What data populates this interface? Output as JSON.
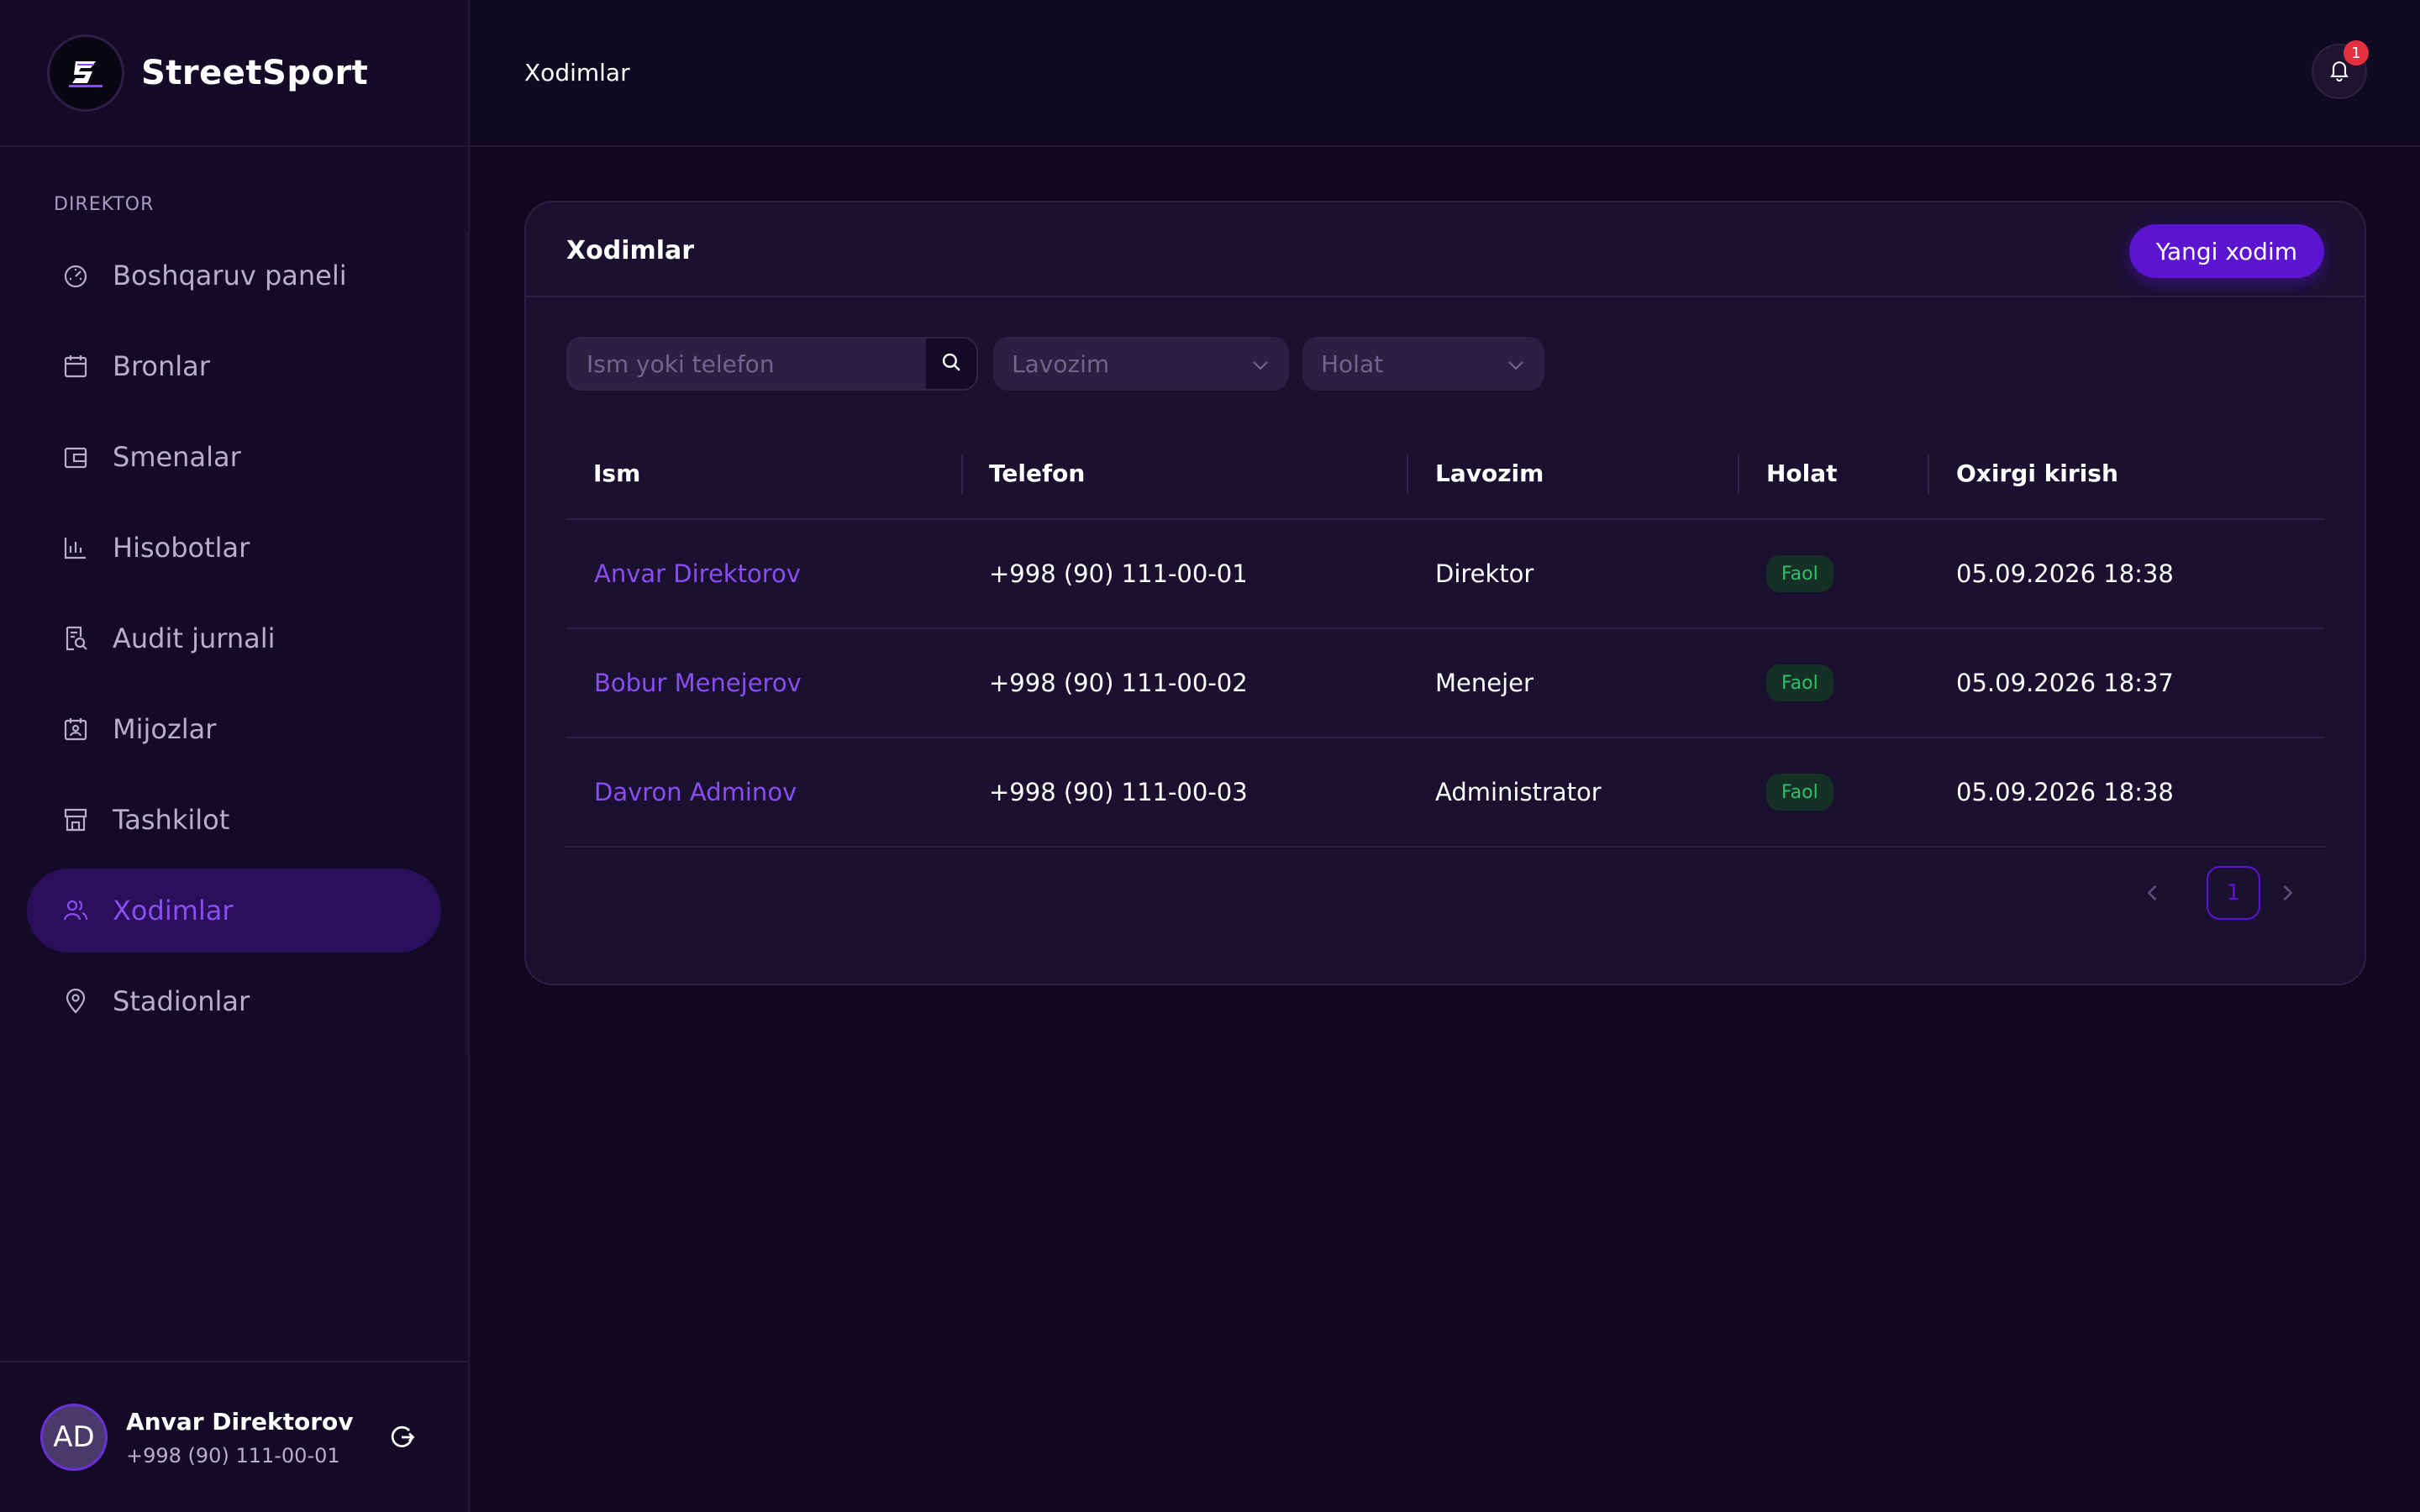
{
  "app": {
    "name": "StreetSport",
    "role": "DIREKTOR"
  },
  "header": {
    "title": "Xodimlar",
    "notification_count": "1"
  },
  "nav": [
    {
      "label": "Boshqaruv paneli",
      "icon": "dashboard-icon"
    },
    {
      "label": "Bronlar",
      "icon": "calendar-icon"
    },
    {
      "label": "Smenalar",
      "icon": "wallet-icon"
    },
    {
      "label": "Hisobotlar",
      "icon": "chart-icon"
    },
    {
      "label": "Audit jurnali",
      "icon": "audit-icon"
    },
    {
      "label": "Mijozlar",
      "icon": "contacts-icon"
    },
    {
      "label": "Tashkilot",
      "icon": "store-icon"
    },
    {
      "label": "Xodimlar",
      "icon": "users-icon",
      "active": true
    },
    {
      "label": "Stadionlar",
      "icon": "location-pin-icon"
    }
  ],
  "user": {
    "initials": "AD",
    "name": "Anvar Direktorov",
    "phone": "+998 (90) 111-00-01"
  },
  "card": {
    "title": "Xodimlar",
    "new_button": "Yangi xodim",
    "search_placeholder": "Ism yoki telefon",
    "role_filter": "Lavozim",
    "status_filter": "Holat"
  },
  "table": {
    "columns": [
      "Ism",
      "Telefon",
      "Lavozim",
      "Holat",
      "Oxirgi kirish"
    ],
    "rows": [
      {
        "name": "Anvar Direktorov",
        "phone": "+998 (90) 111-00-01",
        "role": "Direktor",
        "status": "Faol",
        "last_login": "05.09.2026 18:38"
      },
      {
        "name": "Bobur Menejerov",
        "phone": "+998 (90) 111-00-02",
        "role": "Menejer",
        "status": "Faol",
        "last_login": "05.09.2026 18:37"
      },
      {
        "name": "Davron Adminov",
        "phone": "+998 (90) 111-00-03",
        "role": "Administrator",
        "status": "Faol",
        "last_login": "05.09.2026 18:38"
      }
    ]
  },
  "pagination": {
    "current_page": "1"
  },
  "colors": {
    "accent": "#5b14d0",
    "link": "#8a4df2",
    "status_ok": "#2fc06a",
    "badge_red": "#e5303f"
  }
}
